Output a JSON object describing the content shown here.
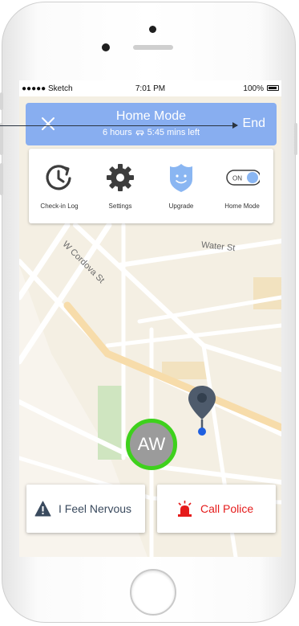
{
  "status_bar": {
    "carrier": "●●●●● Sketch",
    "time": "7:01 PM",
    "battery": "100%"
  },
  "banner": {
    "title": "Home Mode",
    "duration": "6 hours",
    "time_left": "5:45 mins left",
    "end_label": "End"
  },
  "menu": {
    "items": [
      {
        "label": "Check-in Log",
        "icon": "clock-arrow-icon"
      },
      {
        "label": "Settings",
        "icon": "gear-icon"
      },
      {
        "label": "Upgrade",
        "icon": "shield-face-icon"
      },
      {
        "label": "Home Mode",
        "icon": "toggle-icon",
        "toggle_text": "ON",
        "toggle_state": true
      }
    ]
  },
  "map": {
    "streets": [
      "W Cordova St",
      "Water St"
    ]
  },
  "avatar": {
    "initials": "AW",
    "ring_color": "#3ed11c"
  },
  "actions": {
    "nervous_label": "I Feel Nervous",
    "police_label": "Call Police"
  },
  "colors": {
    "banner_blue": "#88aef0",
    "alert_red": "#e51b1b",
    "pin_blue": "#1f5fe0"
  }
}
